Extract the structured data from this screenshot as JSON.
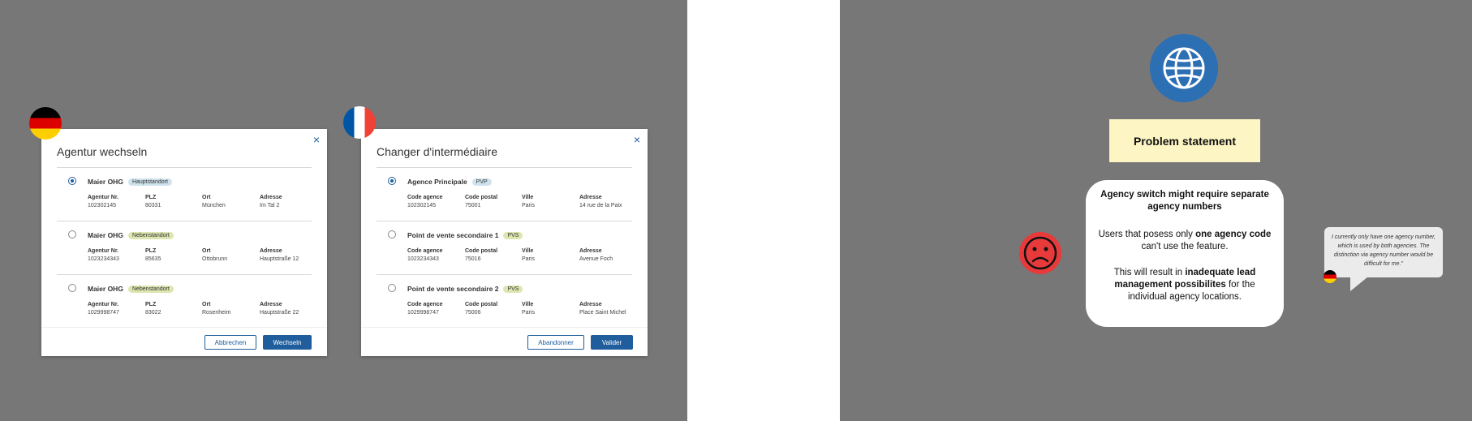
{
  "dialog_de": {
    "title": "Agentur wechseln",
    "close": "×",
    "headers": [
      "Agentur Nr.",
      "PLZ",
      "Ort",
      "Adresse"
    ],
    "rows": [
      {
        "name": "Maier OHG",
        "badge": "Hauptstandort",
        "values": [
          "102302145",
          "80331",
          "München",
          "Im Tal 2"
        ],
        "selected": true
      },
      {
        "name": "Maier OHG",
        "badge": "Nebenstandort",
        "values": [
          "1023234343",
          "85635",
          "Ottobrunn",
          "Hauptstraße 12"
        ],
        "selected": false
      },
      {
        "name": "Maier OHG",
        "badge": "Nebenstandort",
        "values": [
          "1029998747",
          "83022",
          "Rosenheim",
          "Hauptstraße 22"
        ],
        "selected": false
      }
    ],
    "cancel": "Abbrechen",
    "confirm": "Wechseln"
  },
  "dialog_fr": {
    "title": "Changer d'intermédiaire",
    "close": "×",
    "headers": [
      "Code agence",
      "Code postal",
      "Ville",
      "Adresse"
    ],
    "rows": [
      {
        "name": "Agence Principale",
        "badge": "PVP",
        "values": [
          "102302145",
          "75001",
          "Paris",
          "14 rue de la Paix"
        ],
        "selected": true
      },
      {
        "name": "Point de vente secondaire 1",
        "badge": "PVS",
        "values": [
          "1023234343",
          "75016",
          "Paris",
          "Avenue Foch"
        ],
        "selected": false
      },
      {
        "name": "Point de vente secondaire 2",
        "badge": "PVS",
        "values": [
          "1029998747",
          "75006",
          "Paris",
          "Place Saint Michel"
        ],
        "selected": false
      }
    ],
    "cancel": "Abandonner",
    "confirm": "Valider"
  },
  "problem": {
    "title": "Problem statement",
    "headline": "Agency switch might require separate agency numbers",
    "p2_a": "Users that posess only ",
    "p2_b": "one agency code",
    "p2_c": " can't use the feature.",
    "p3_a": "This will result in ",
    "p3_b": "inadequate lead management possibilites",
    "p3_c": " for the individual agency locations."
  },
  "quote": "I currently only have one agency number, which is used by both agencies. The distinction via agency number would be difficult for me.\"",
  "colors": {
    "accent": "#1f5d9c",
    "globe": "#2c6fb3",
    "sad": "#e83a3a",
    "note": "#fdf5c3"
  },
  "icons": [
    "german-flag-icon",
    "french-flag-icon",
    "close-icon",
    "globe-icon",
    "sad-face-icon"
  ]
}
